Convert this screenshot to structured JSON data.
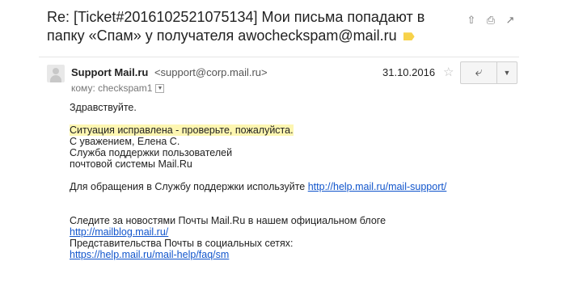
{
  "subject": "Re: [Ticket#2016102521075134] Мои письма попадают в папку «Спам» у получателя awocheckspam@mail.ru",
  "toolbar": {
    "print_icon": "print-icon",
    "popout_icon": "new-window-icon",
    "archive_icon": "archive-icon"
  },
  "sender": {
    "name": "Support Mail.ru",
    "email": "<support@corp.mail.ru>"
  },
  "recipient": {
    "label": "кому: checkspam1"
  },
  "date": "31.10.2016",
  "message": {
    "greeting": "Здравствуйте.",
    "highlight": "Ситуация исправлена - проверьте, пожалуйста.",
    "sign1": "С уважением, Елена С.",
    "sign2": "Служба поддержки пользователей",
    "sign3": "почтовой системы Mail.Ru",
    "support_prefix": "Для обращения в Службу поддержки используйте ",
    "support_link": "http://help.mail.ru/mail-support/",
    "news": "Следите за новостями Почты Mail.Ru в нашем официальном блоге",
    "blog_link": "http://mailblog.mail.ru/",
    "social": "Представительства Почты в социальных сетях:",
    "faq_link": "https://help.mail.ru/mail-help/faq/sm"
  },
  "colors": {
    "link": "#1155cc",
    "highlight": "#fdf6b1",
    "label_tag": "#f7d24a"
  }
}
